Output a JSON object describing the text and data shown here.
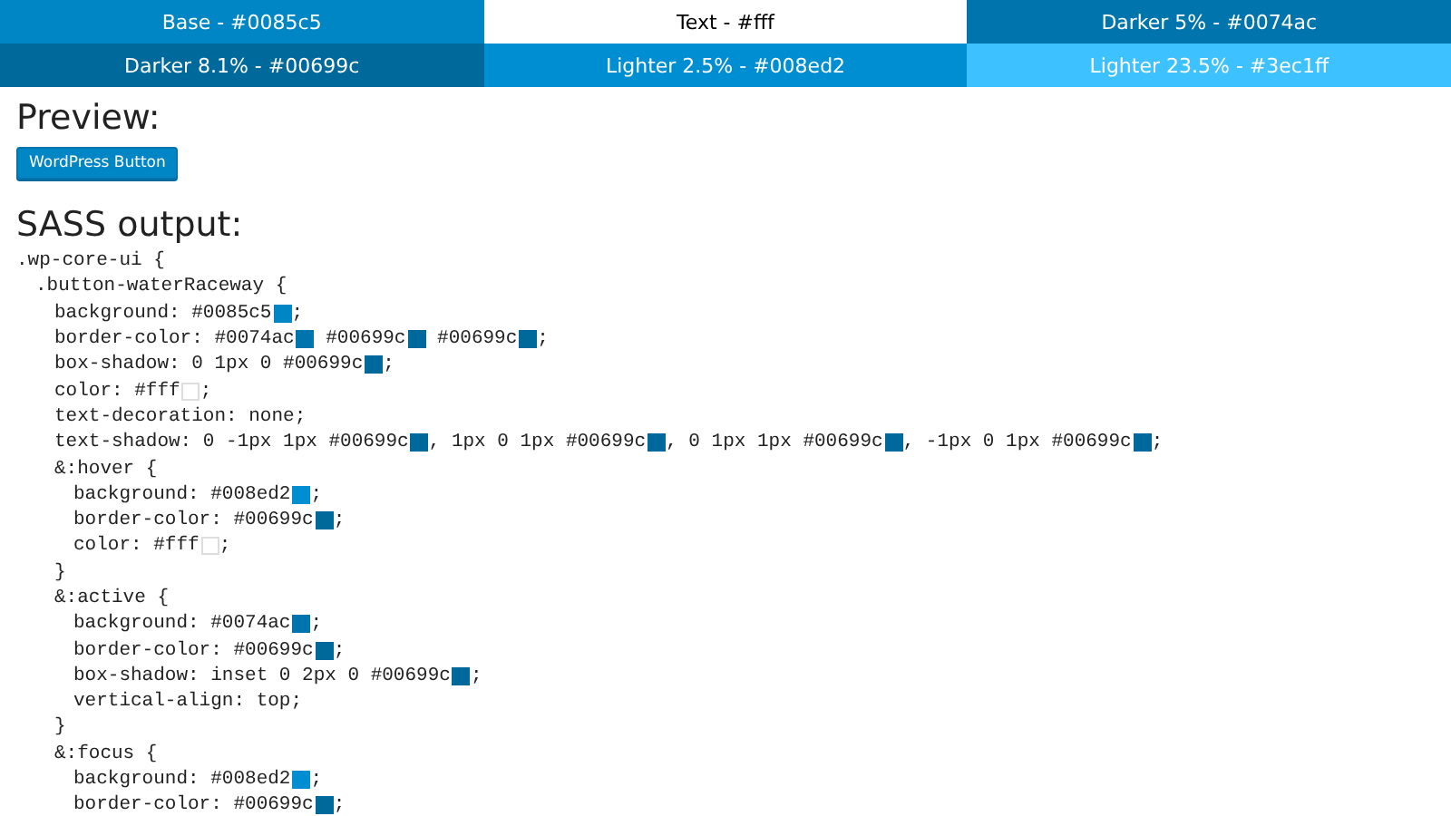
{
  "swatches": [
    {
      "label": "Base - #0085c5",
      "color": "#0085c5",
      "dark_text": false
    },
    {
      "label": "Text - #fff",
      "color": "#ffffff",
      "dark_text": true
    },
    {
      "label": "Darker 5% - #0074ac",
      "color": "#0074ac",
      "dark_text": false
    },
    {
      "label": "Darker 8.1% - #00699c",
      "color": "#00699c",
      "dark_text": false
    },
    {
      "label": "Lighter 2.5% - #008ed2",
      "color": "#008ed2",
      "dark_text": false
    },
    {
      "label": "Lighter 23.5% - #3ec1ff",
      "color": "#3ec1ff",
      "dark_text": false
    }
  ],
  "preview": {
    "heading": "Preview:",
    "button": "WordPress Button"
  },
  "sass": {
    "heading": "SASS output:",
    "code": [
      {
        "kind": "block",
        "header": ".wp-core-ui {",
        "children": [
          {
            "kind": "block",
            "header": ".button-waterRaceway {",
            "children": [
              {
                "kind": "line",
                "parts": [
                  {
                    "kind": "text",
                    "text": "background: #0085c5"
                  },
                  {
                    "kind": "swatch",
                    "color": "#0085c5"
                  },
                  {
                    "kind": "text",
                    "text": ";"
                  }
                ]
              },
              {
                "kind": "line",
                "parts": [
                  {
                    "kind": "text",
                    "text": "border-color: #0074ac"
                  },
                  {
                    "kind": "swatch",
                    "color": "#0074ac"
                  },
                  {
                    "kind": "text",
                    "text": " #00699c"
                  },
                  {
                    "kind": "swatch",
                    "color": "#00699c"
                  },
                  {
                    "kind": "text",
                    "text": " #00699c"
                  },
                  {
                    "kind": "swatch",
                    "color": "#00699c"
                  },
                  {
                    "kind": "text",
                    "text": ";"
                  }
                ]
              },
              {
                "kind": "line",
                "parts": [
                  {
                    "kind": "text",
                    "text": "box-shadow: 0 1px 0 #00699c"
                  },
                  {
                    "kind": "swatch",
                    "color": "#00699c"
                  },
                  {
                    "kind": "text",
                    "text": ";"
                  }
                ]
              },
              {
                "kind": "line",
                "parts": [
                  {
                    "kind": "text",
                    "text": "color: #fff"
                  },
                  {
                    "kind": "swatch",
                    "color": "#ffffff"
                  },
                  {
                    "kind": "text",
                    "text": ";"
                  }
                ]
              },
              {
                "kind": "line",
                "parts": [
                  {
                    "kind": "text",
                    "text": "text-decoration: none;"
                  }
                ]
              },
              {
                "kind": "line",
                "parts": [
                  {
                    "kind": "text",
                    "text": "text-shadow: 0 -1px 1px #00699c"
                  },
                  {
                    "kind": "swatch",
                    "color": "#00699c"
                  },
                  {
                    "kind": "text",
                    "text": ", 1px 0 1px #00699c"
                  },
                  {
                    "kind": "swatch",
                    "color": "#00699c"
                  },
                  {
                    "kind": "text",
                    "text": ", 0 1px 1px #00699c"
                  },
                  {
                    "kind": "swatch",
                    "color": "#00699c"
                  },
                  {
                    "kind": "text",
                    "text": ", -1px 0 1px #00699c"
                  },
                  {
                    "kind": "swatch",
                    "color": "#00699c"
                  },
                  {
                    "kind": "text",
                    "text": ";"
                  }
                ]
              },
              {
                "kind": "block",
                "header": "&:hover {",
                "close": "}",
                "children": [
                  {
                    "kind": "line",
                    "parts": [
                      {
                        "kind": "text",
                        "text": "background: #008ed2"
                      },
                      {
                        "kind": "swatch",
                        "color": "#008ed2"
                      },
                      {
                        "kind": "text",
                        "text": ";"
                      }
                    ]
                  },
                  {
                    "kind": "line",
                    "parts": [
                      {
                        "kind": "text",
                        "text": "border-color: #00699c"
                      },
                      {
                        "kind": "swatch",
                        "color": "#00699c"
                      },
                      {
                        "kind": "text",
                        "text": ";"
                      }
                    ]
                  },
                  {
                    "kind": "line",
                    "parts": [
                      {
                        "kind": "text",
                        "text": "color: #fff"
                      },
                      {
                        "kind": "swatch",
                        "color": "#ffffff"
                      },
                      {
                        "kind": "text",
                        "text": ";"
                      }
                    ]
                  }
                ]
              },
              {
                "kind": "block",
                "header": "&:active {",
                "close": "}",
                "children": [
                  {
                    "kind": "line",
                    "parts": [
                      {
                        "kind": "text",
                        "text": "background: #0074ac"
                      },
                      {
                        "kind": "swatch",
                        "color": "#0074ac"
                      },
                      {
                        "kind": "text",
                        "text": ";"
                      }
                    ]
                  },
                  {
                    "kind": "line",
                    "parts": [
                      {
                        "kind": "text",
                        "text": "border-color: #00699c"
                      },
                      {
                        "kind": "swatch",
                        "color": "#00699c"
                      },
                      {
                        "kind": "text",
                        "text": ";"
                      }
                    ]
                  },
                  {
                    "kind": "line",
                    "parts": [
                      {
                        "kind": "text",
                        "text": "box-shadow: inset 0 2px 0 #00699c"
                      },
                      {
                        "kind": "swatch",
                        "color": "#00699c"
                      },
                      {
                        "kind": "text",
                        "text": ";"
                      }
                    ]
                  },
                  {
                    "kind": "line",
                    "parts": [
                      {
                        "kind": "text",
                        "text": "vertical-align: top;"
                      }
                    ]
                  }
                ]
              },
              {
                "kind": "block",
                "header": "&:focus {",
                "children": [
                  {
                    "kind": "line",
                    "parts": [
                      {
                        "kind": "text",
                        "text": "background: #008ed2"
                      },
                      {
                        "kind": "swatch",
                        "color": "#008ed2"
                      },
                      {
                        "kind": "text",
                        "text": ";"
                      }
                    ]
                  },
                  {
                    "kind": "line",
                    "parts": [
                      {
                        "kind": "text",
                        "text": "border-color: #00699c"
                      },
                      {
                        "kind": "swatch",
                        "color": "#00699c"
                      },
                      {
                        "kind": "text",
                        "text": ";"
                      }
                    ]
                  }
                ]
              }
            ]
          }
        ]
      }
    ]
  }
}
